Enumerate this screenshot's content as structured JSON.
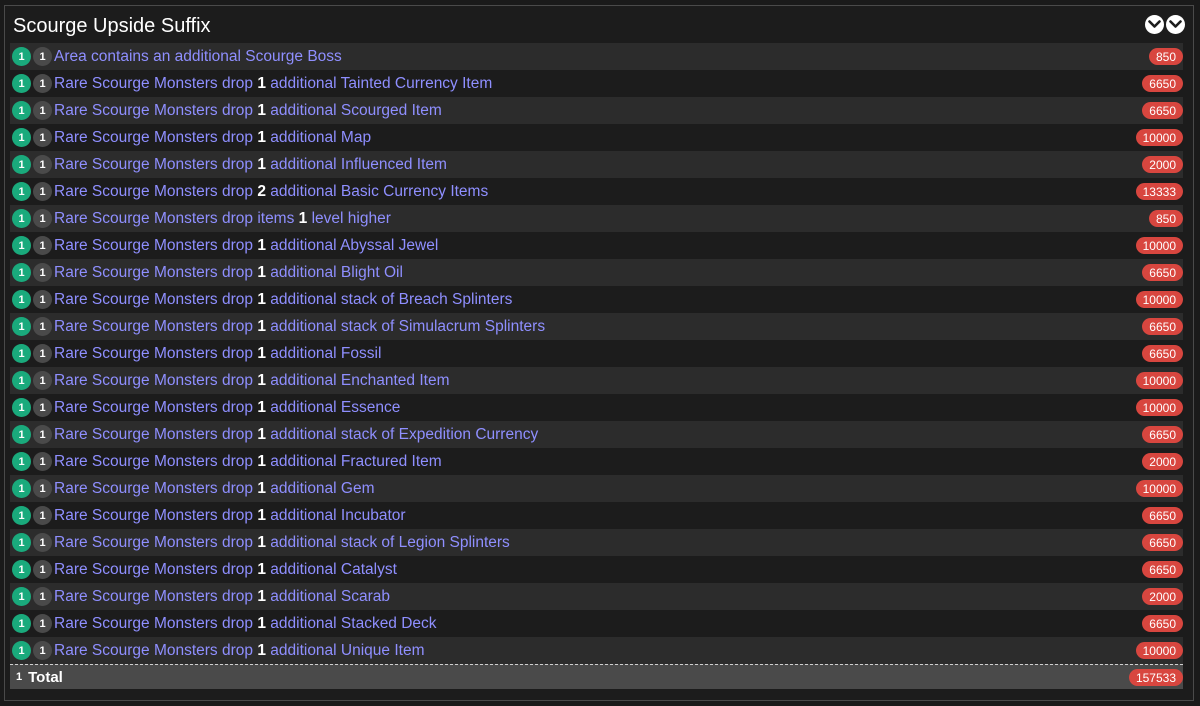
{
  "panel": {
    "title": "Scourge Upside Suffix",
    "collapse_icon": "double-chevron-down-icon"
  },
  "rows": [
    {
      "green": "1",
      "gray": "1",
      "pre": "Area contains an additional Scourge Boss",
      "num": "",
      "post": "",
      "weight": "850"
    },
    {
      "green": "1",
      "gray": "1",
      "pre": "Rare Scourge Monsters drop ",
      "num": "1",
      "post": " additional Tainted Currency Item",
      "weight": "6650"
    },
    {
      "green": "1",
      "gray": "1",
      "pre": "Rare Scourge Monsters drop ",
      "num": "1",
      "post": " additional Scourged Item",
      "weight": "6650"
    },
    {
      "green": "1",
      "gray": "1",
      "pre": "Rare Scourge Monsters drop ",
      "num": "1",
      "post": " additional Map",
      "weight": "10000"
    },
    {
      "green": "1",
      "gray": "1",
      "pre": "Rare Scourge Monsters drop ",
      "num": "1",
      "post": " additional Influenced Item",
      "weight": "2000"
    },
    {
      "green": "1",
      "gray": "1",
      "pre": "Rare Scourge Monsters drop ",
      "num": "2",
      "post": " additional Basic Currency Items",
      "weight": "13333"
    },
    {
      "green": "1",
      "gray": "1",
      "pre": "Rare Scourge Monsters drop items ",
      "num": "1",
      "post": " level higher",
      "weight": "850"
    },
    {
      "green": "1",
      "gray": "1",
      "pre": "Rare Scourge Monsters drop ",
      "num": "1",
      "post": " additional Abyssal Jewel",
      "weight": "10000"
    },
    {
      "green": "1",
      "gray": "1",
      "pre": "Rare Scourge Monsters drop ",
      "num": "1",
      "post": " additional Blight Oil",
      "weight": "6650"
    },
    {
      "green": "1",
      "gray": "1",
      "pre": "Rare Scourge Monsters drop ",
      "num": "1",
      "post": " additional stack of Breach Splinters",
      "weight": "10000"
    },
    {
      "green": "1",
      "gray": "1",
      "pre": "Rare Scourge Monsters drop ",
      "num": "1",
      "post": " additional stack of Simulacrum Splinters",
      "weight": "6650"
    },
    {
      "green": "1",
      "gray": "1",
      "pre": "Rare Scourge Monsters drop ",
      "num": "1",
      "post": " additional Fossil",
      "weight": "6650"
    },
    {
      "green": "1",
      "gray": "1",
      "pre": "Rare Scourge Monsters drop ",
      "num": "1",
      "post": " additional Enchanted Item",
      "weight": "10000"
    },
    {
      "green": "1",
      "gray": "1",
      "pre": "Rare Scourge Monsters drop ",
      "num": "1",
      "post": " additional Essence",
      "weight": "10000"
    },
    {
      "green": "1",
      "gray": "1",
      "pre": "Rare Scourge Monsters drop ",
      "num": "1",
      "post": " additional stack of Expedition Currency",
      "weight": "6650"
    },
    {
      "green": "1",
      "gray": "1",
      "pre": "Rare Scourge Monsters drop ",
      "num": "1",
      "post": " additional Fractured Item",
      "weight": "2000"
    },
    {
      "green": "1",
      "gray": "1",
      "pre": "Rare Scourge Monsters drop ",
      "num": "1",
      "post": " additional Gem",
      "weight": "10000"
    },
    {
      "green": "1",
      "gray": "1",
      "pre": "Rare Scourge Monsters drop ",
      "num": "1",
      "post": " additional Incubator",
      "weight": "6650"
    },
    {
      "green": "1",
      "gray": "1",
      "pre": "Rare Scourge Monsters drop ",
      "num": "1",
      "post": " additional stack of Legion Splinters",
      "weight": "6650"
    },
    {
      "green": "1",
      "gray": "1",
      "pre": "Rare Scourge Monsters drop ",
      "num": "1",
      "post": " additional Catalyst",
      "weight": "6650"
    },
    {
      "green": "1",
      "gray": "1",
      "pre": "Rare Scourge Monsters drop ",
      "num": "1",
      "post": " additional Scarab",
      "weight": "2000"
    },
    {
      "green": "1",
      "gray": "1",
      "pre": "Rare Scourge Monsters drop ",
      "num": "1",
      "post": " additional Stacked Deck",
      "weight": "6650"
    },
    {
      "green": "1",
      "gray": "1",
      "pre": "Rare Scourge Monsters drop ",
      "num": "1",
      "post": " additional Unique Item",
      "weight": "10000"
    }
  ],
  "total": {
    "count": "1",
    "label": "Total",
    "weight": "157533"
  },
  "colors": {
    "mod_text": "#8f8fff",
    "green_badge": "#1aaa7c",
    "weight_badge": "#d8463f"
  }
}
